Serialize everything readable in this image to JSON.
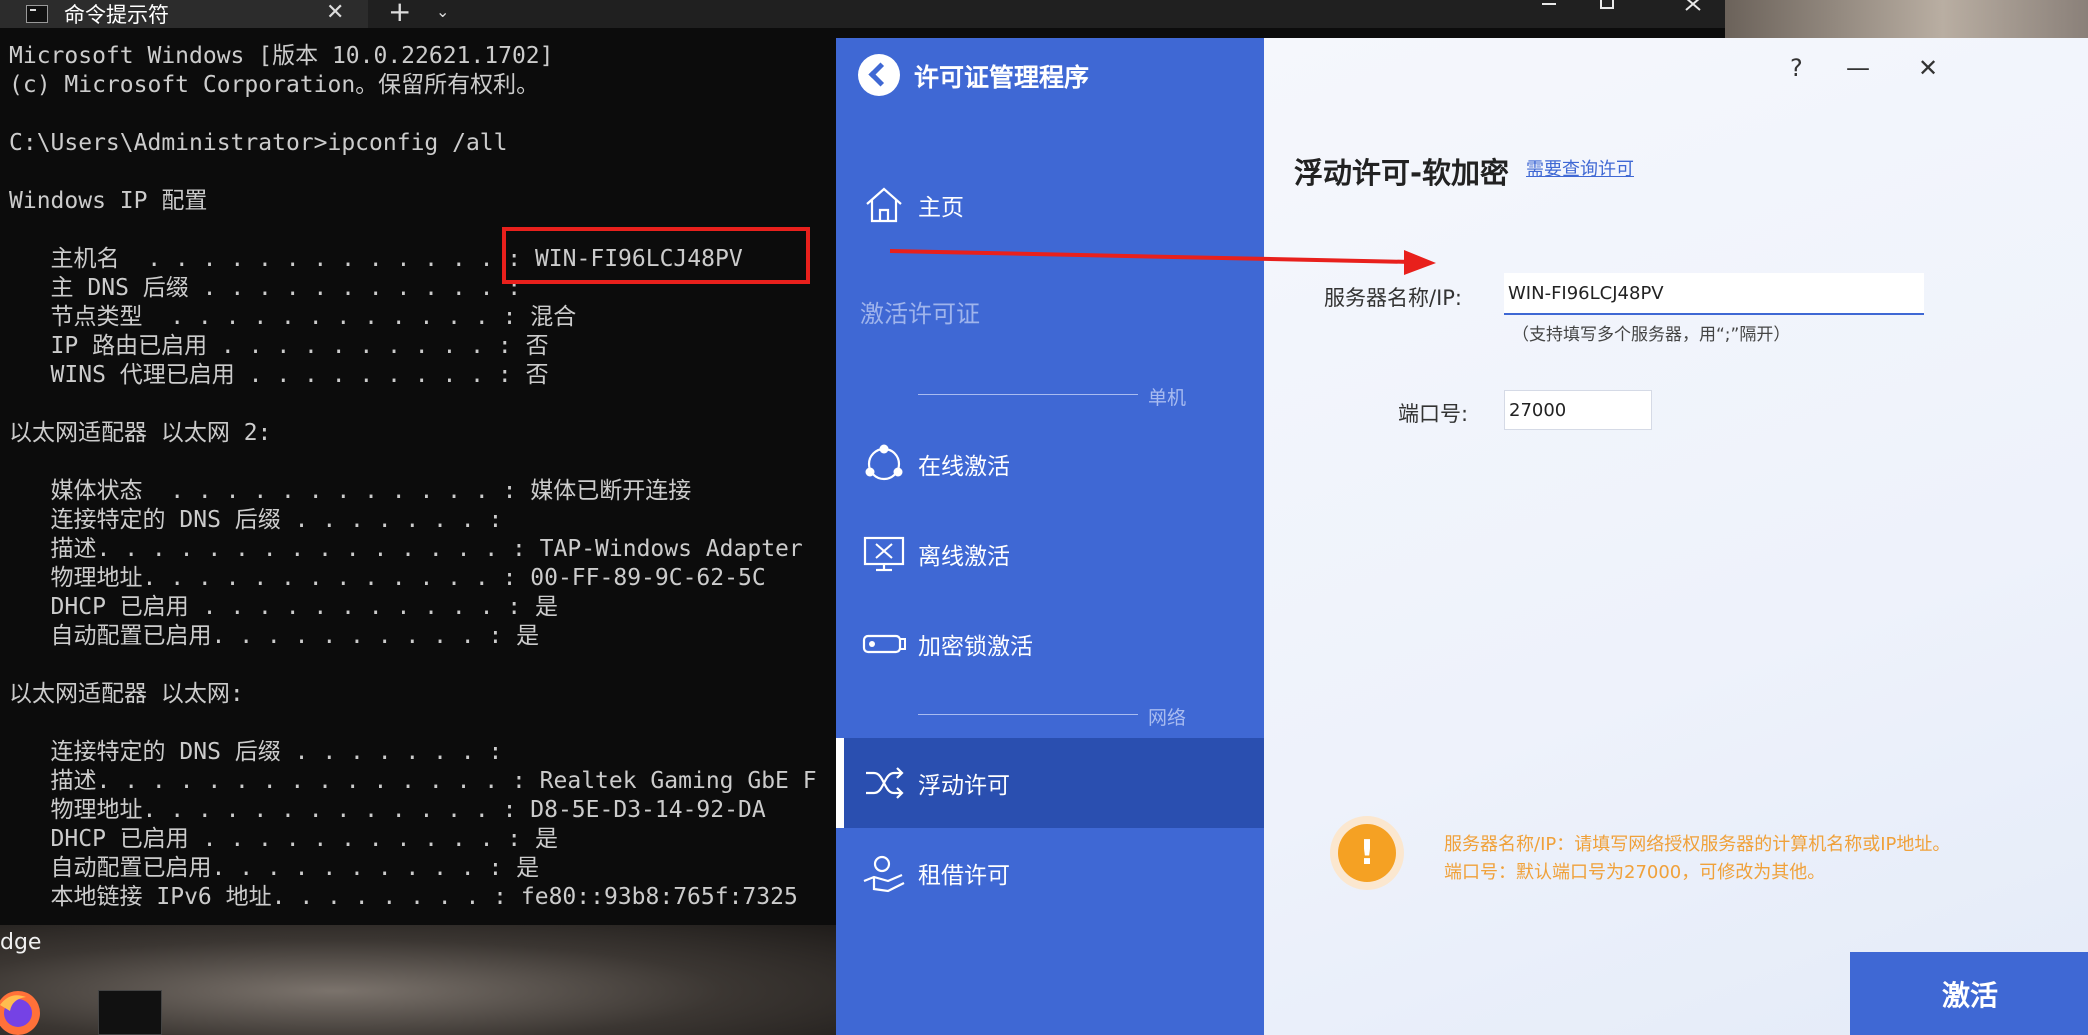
{
  "desktop": {
    "edge_label": "dge"
  },
  "cmd": {
    "tab_title": "命令提示符",
    "tab_close": "✕",
    "new_tab": "+",
    "dropdown": "⌄",
    "lines": [
      "Microsoft Windows [版本 10.0.22621.1702]",
      "(c) Microsoft Corporation。保留所有权利。",
      "",
      "C:\\Users\\Administrator>ipconfig /all",
      "",
      "Windows IP 配置",
      "",
      "   主机名  . . . . . . . . . . . . . : WIN-FI96LCJ48PV",
      "   主 DNS 后缀 . . . . . . . . . . . :",
      "   节点类型  . . . . . . . . . . . . : 混合",
      "   IP 路由已启用 . . . . . . . . . . : 否",
      "   WINS 代理已启用 . . . . . . . . . : 否",
      "",
      "以太网适配器 以太网 2:",
      "",
      "   媒体状态  . . . . . . . . . . . . : 媒体已断开连接",
      "   连接特定的 DNS 后缀 . . . . . . . :",
      "   描述. . . . . . . . . . . . . . . : TAP-Windows Adapter",
      "   物理地址. . . . . . . . . . . . . : 00-FF-89-9C-62-5C",
      "   DHCP 已启用 . . . . . . . . . . . : 是",
      "   自动配置已启用. . . . . . . . . . : 是",
      "",
      "以太网适配器 以太网:",
      "",
      "   连接特定的 DNS 后缀 . . . . . . . :",
      "   描述. . . . . . . . . . . . . . . : Realtek Gaming GbE F",
      "   物理地址. . . . . . . . . . . . . : D8-5E-D3-14-92-DA",
      "   DHCP 已启用 . . . . . . . . . . . : 是",
      "   自动配置已启用. . . . . . . . . . : 是",
      "   本地链接 IPv6 地址. . . . . . . . : fe80::93b8:765f:7325"
    ]
  },
  "app": {
    "title": "许可证管理程序",
    "window_help": "?",
    "window_minimize": "—",
    "window_close": "✕",
    "nav": {
      "home": "主页",
      "activate_section": "激活许可证",
      "standalone_section": "单机",
      "online": "在线激活",
      "offline": "离线激活",
      "dongle": "加密锁激活",
      "network_section": "网络",
      "floating": "浮动许可",
      "borrow": "租借许可"
    },
    "main": {
      "heading": "浮动许可-软加密",
      "query_link": "需要查询许可",
      "server_label": "服务器名称/IP:",
      "server_value": "WIN-FI96LCJ48PV",
      "server_hint": "（支持填写多个服务器，用“;”隔开）",
      "port_label": "端口号:",
      "port_value": "27000",
      "warn_icon": "!",
      "warn_line1": "服务器名称/IP：请填写网络授权服务器的计算机名称或IP地址。",
      "warn_line2": "端口号：默认端口号为27000，可修改为其他。",
      "activate_button": "激活"
    }
  },
  "colors": {
    "sidebar": "#3f68d4",
    "sidebar_selected": "#2a4fb0",
    "highlight_box": "#e8201c",
    "warning": "#f5a123"
  }
}
